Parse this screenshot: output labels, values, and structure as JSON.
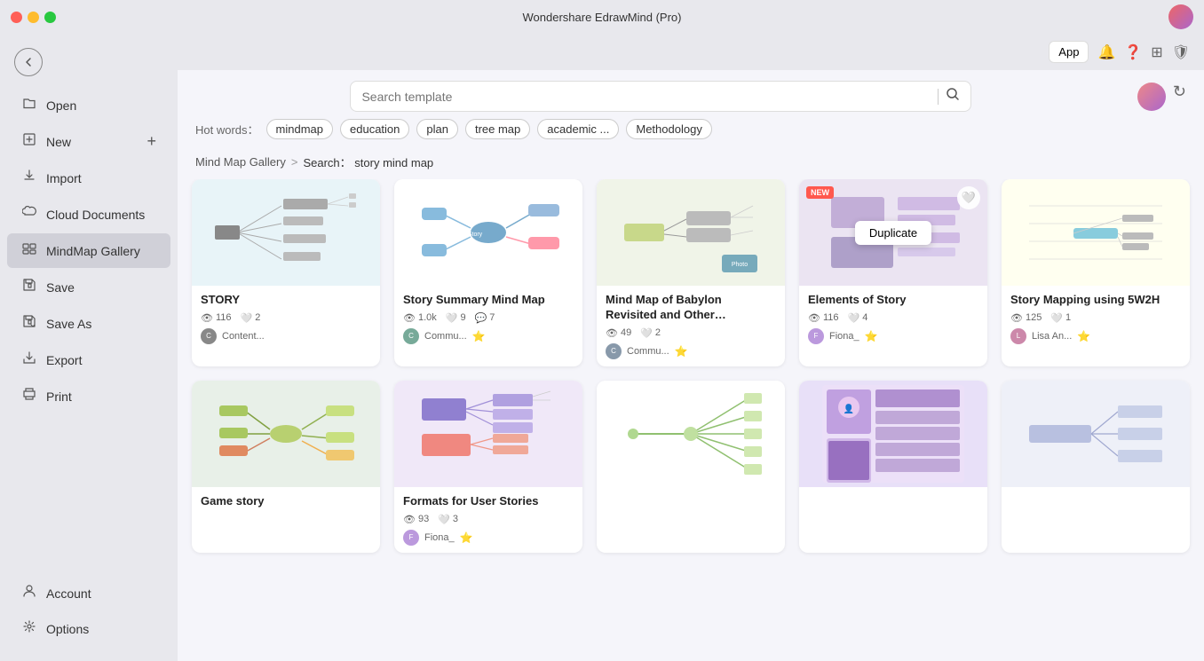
{
  "app": {
    "title": "Wondershare EdrawMind (Pro)"
  },
  "sidebar": {
    "items": [
      {
        "id": "open",
        "label": "Open",
        "icon": "📂"
      },
      {
        "id": "new",
        "label": "New",
        "icon": "📄",
        "hasPlus": true
      },
      {
        "id": "import",
        "label": "Import",
        "icon": "📥"
      },
      {
        "id": "cloud",
        "label": "Cloud Documents",
        "icon": "☁️"
      },
      {
        "id": "mindmap-gallery",
        "label": "MindMap Gallery",
        "icon": "🗺️",
        "active": true
      },
      {
        "id": "save",
        "label": "Save",
        "icon": "💾"
      },
      {
        "id": "save-as",
        "label": "Save As",
        "icon": "📋"
      },
      {
        "id": "export",
        "label": "Export",
        "icon": "📤"
      },
      {
        "id": "print",
        "label": "Print",
        "icon": "🖨️"
      }
    ],
    "bottom": [
      {
        "id": "account",
        "label": "Account",
        "icon": "👤"
      },
      {
        "id": "options",
        "label": "Options",
        "icon": "⚙️"
      }
    ]
  },
  "header": {
    "app_btn": "App",
    "search_placeholder": "Search template"
  },
  "hot_words": {
    "label": "Hot words：",
    "tags": [
      "mindmap",
      "education",
      "plan",
      "tree map",
      "academic ...",
      "Methodology"
    ]
  },
  "breadcrumb": {
    "gallery": "Mind Map Gallery",
    "separator": ">",
    "search_label": "Search：",
    "search_term": "story mind map"
  },
  "gallery": {
    "cards": [
      {
        "id": "story",
        "title": "STORY",
        "views": "116",
        "likes": "2",
        "comments": "",
        "author": "Content...",
        "author_color": "#888",
        "thumb_type": "story-tree",
        "has_badge": false,
        "has_heart": false,
        "show_duplicate": false
      },
      {
        "id": "story-summary",
        "title": "Story Summary Mind Map",
        "views": "1.0k",
        "likes": "9",
        "comments": "7",
        "author": "Commu...",
        "author_color": "#7a9",
        "gold": true,
        "thumb_type": "story-summary",
        "has_badge": false,
        "has_heart": false,
        "show_duplicate": false
      },
      {
        "id": "babylon",
        "title": "Mind Map of Babylon Revisited and Other…",
        "views": "49",
        "likes": "2",
        "comments": "",
        "author": "Commu...",
        "author_color": "#89a",
        "gold": true,
        "thumb_type": "babylon",
        "has_badge": false,
        "has_heart": false,
        "show_duplicate": false
      },
      {
        "id": "elements-story",
        "title": "Elements of Story",
        "views": "116",
        "likes": "4",
        "comments": "",
        "author": "Fiona_",
        "author_color": "#b9d",
        "gold": true,
        "thumb_type": "elements",
        "has_badge": true,
        "badge_text": "NEW",
        "has_heart": true,
        "show_duplicate": true
      },
      {
        "id": "story-mapping",
        "title": "Story Mapping using 5W2H",
        "views": "125",
        "likes": "1",
        "comments": "",
        "author": "Lisa An...",
        "author_color": "#c8a",
        "gold": true,
        "thumb_type": "mapping5w2h",
        "has_badge": false,
        "has_heart": false,
        "show_duplicate": false
      },
      {
        "id": "game-story",
        "title": "Game story",
        "views": "",
        "likes": "",
        "comments": "",
        "author": "",
        "thumb_type": "game-story",
        "has_badge": false,
        "has_heart": false,
        "show_duplicate": false
      },
      {
        "id": "formats-user-stories",
        "title": "Formats for User Stories",
        "views": "93",
        "likes": "3",
        "comments": "",
        "author": "Fiona_",
        "author_color": "#b9d",
        "gold": true,
        "thumb_type": "formats",
        "has_badge": false,
        "has_heart": false,
        "show_duplicate": false
      },
      {
        "id": "story-map2",
        "title": "",
        "views": "",
        "likes": "",
        "comments": "",
        "author": "",
        "thumb_type": "story-map2",
        "has_badge": false,
        "has_heart": false,
        "show_duplicate": false
      },
      {
        "id": "story-game2",
        "title": "",
        "views": "",
        "likes": "",
        "comments": "",
        "author": "",
        "thumb_type": "story-game2",
        "has_badge": false,
        "has_heart": false,
        "show_duplicate": false
      },
      {
        "id": "card-10",
        "title": "",
        "views": "",
        "likes": "",
        "comments": "",
        "author": "",
        "thumb_type": "card10",
        "has_badge": false,
        "has_heart": false,
        "show_duplicate": false
      }
    ]
  }
}
